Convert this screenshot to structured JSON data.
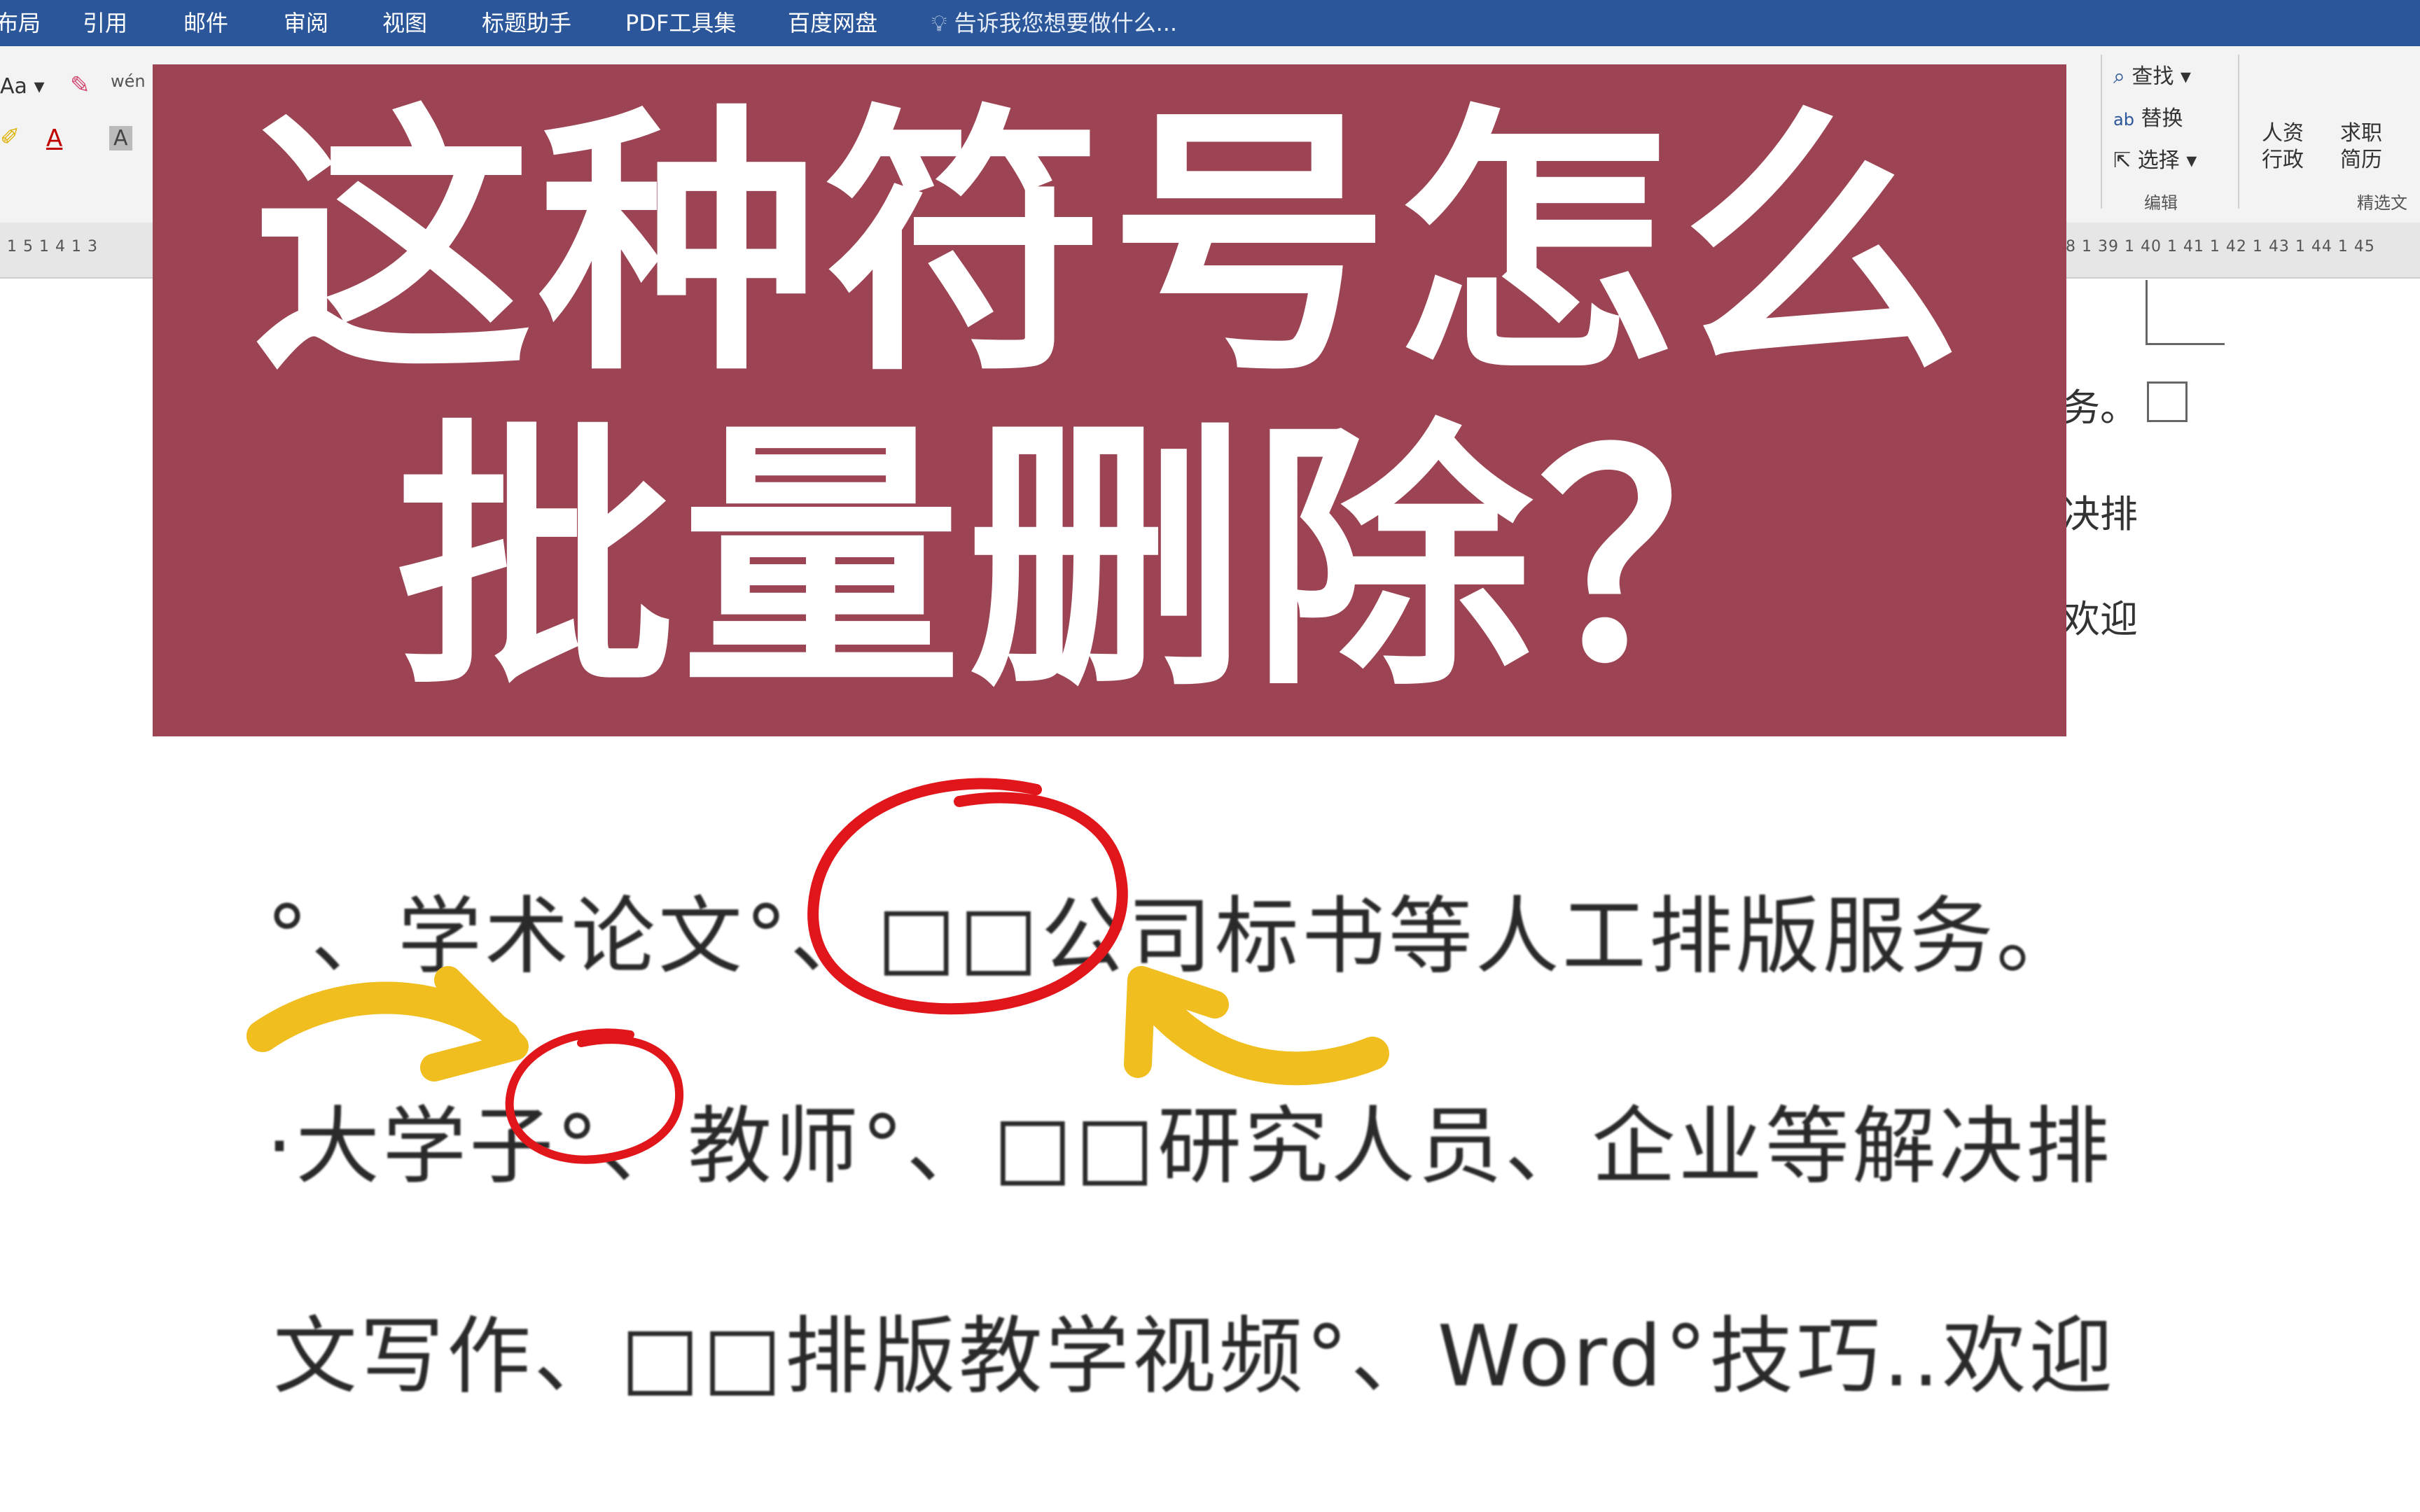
{
  "menubar": {
    "tabs": [
      "布局",
      "引用",
      "邮件",
      "审阅",
      "视图",
      "标题助手",
      "PDF工具集",
      "百度网盘"
    ],
    "tellme": "告诉我您想要做什么..."
  },
  "ribbon": {
    "find": "查找",
    "replace": "替换",
    "select": "选择",
    "editing_group": "编辑",
    "hr_admin_1": "人资",
    "hr_admin_2": "行政",
    "job_resume_1": "求职",
    "job_resume_2": "简历",
    "featured_group": "精选文",
    "font_size_btn": "Aa",
    "phonetic_btn": "wén"
  },
  "ruler": {
    "left_numbers": "1 5 1 4 1 3",
    "right_numbers": "8 1 39 1 40 1 41 1 42 1 43 1 44 1 45"
  },
  "banner": {
    "line1": "这种符号怎么",
    "line2": "批量删除？"
  },
  "document": {
    "line1": "°、学术论文°、□□公司标书等人工排版服务。",
    "line2": "·大学子°、教师°、□□研究人员、企业等解决排",
    "line3": "文写作、□□排版教学视频°、Word°技巧..欢迎"
  },
  "side_text": {
    "line1": "务。",
    "line2": "决排",
    "line3": "欢迎"
  },
  "colors": {
    "banner": "#9d4454",
    "menubar": "#2b579a",
    "circle": "#e0161b",
    "arrow": "#f0be1e"
  }
}
